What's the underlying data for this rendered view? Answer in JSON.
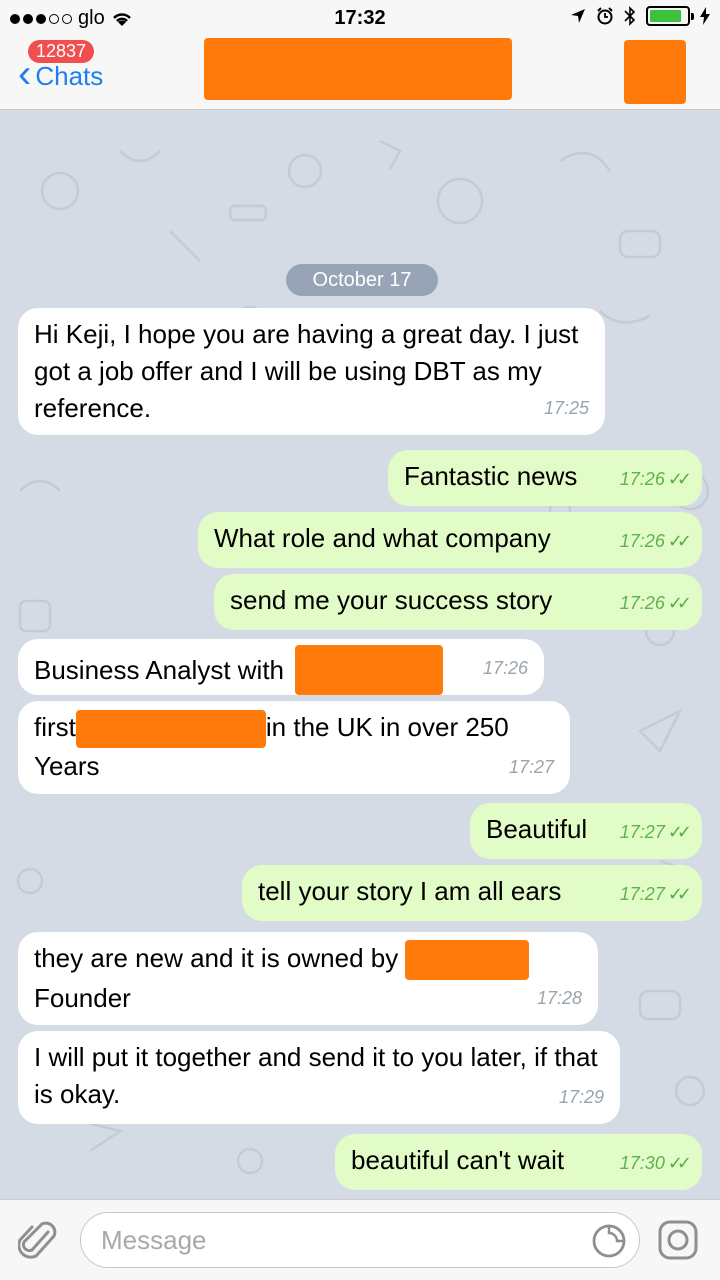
{
  "status_bar": {
    "carrier": "glo",
    "time": "17:32",
    "icons": [
      "signal-dots-icon",
      "wifi-icon",
      "location-arrow-icon",
      "alarm-icon",
      "bluetooth-icon",
      "battery-icon",
      "charging-bolt-icon"
    ],
    "battery_level": 0.85
  },
  "nav": {
    "back_label": "Chats",
    "unread_badge": "12837"
  },
  "chat": {
    "date_separator": "October 17",
    "messages": [
      {
        "dir": "in",
        "text": "Hi Keji, I hope you are having a great day. I just got a job offer and I will be using DBT as my reference.",
        "time": "17:25"
      },
      {
        "dir": "out",
        "text": "Fantastic news",
        "time": "17:26"
      },
      {
        "dir": "out",
        "text": "What role and what company",
        "time": "17:26"
      },
      {
        "dir": "out",
        "text": "send me your success story",
        "time": "17:26"
      },
      {
        "dir": "in",
        "text_before": "Business Analyst with",
        "time": "17:26"
      },
      {
        "dir": "in",
        "text_before": "first",
        "text_after": "in the UK in over 250",
        "text_line2": "Years",
        "time": "17:27"
      },
      {
        "dir": "out",
        "text": "Beautiful",
        "time": "17:27"
      },
      {
        "dir": "out",
        "text": "tell your story I am all ears",
        "time": "17:27"
      },
      {
        "dir": "in",
        "text_before": "they are new and it is owned by",
        "text_line2": "Founder",
        "time": "17:28"
      },
      {
        "dir": "in",
        "text": "I will put it together and send it to you later, if that is okay.",
        "time": "17:29"
      },
      {
        "dir": "out",
        "text": "beautiful can't wait",
        "time": "17:30"
      }
    ],
    "read_ticks": "✓✓",
    "colors": {
      "incoming": "#ffffff",
      "outgoing": "#e2fcc8",
      "redaction": "#ff7a0a",
      "link_blue": "#1f7ef0"
    }
  },
  "composer": {
    "placeholder": "Message"
  }
}
